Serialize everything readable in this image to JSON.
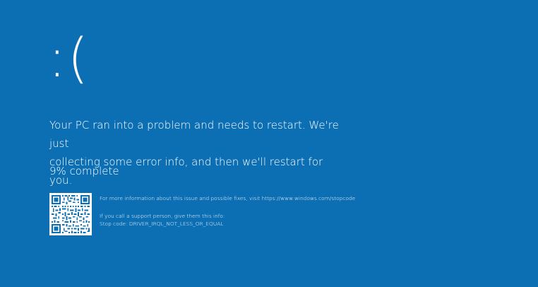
{
  "screen": {
    "background_color": "#0c6fb4",
    "text_color": "#ffffff",
    "sad_face": ":(",
    "message_line_1": "Your PC ran into a problem and needs to restart. We're just",
    "message_line_2": "collecting some error info, and then we'll restart for you.",
    "progress_text": "9% complete",
    "progress_value": 0.09,
    "more_info_text": "For more information about this issue and possible fixes, visit https://www.windows.com/stopcode",
    "support_text": "If you call a support person, give them this info:",
    "stop_code_text": "Stop code: DRIVER_IRQL_NOT_LESS_OR_EQUAL",
    "qr_code_icon": "qr-code-icon"
  }
}
